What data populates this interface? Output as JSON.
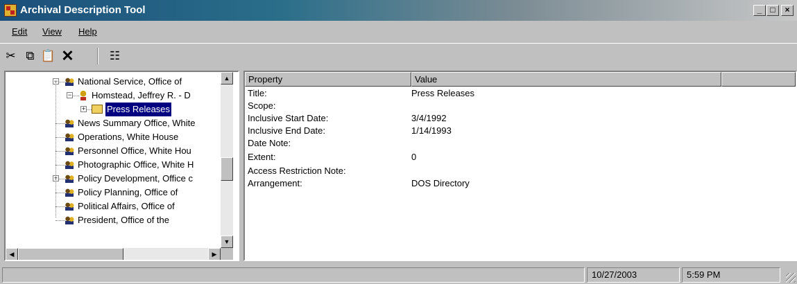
{
  "window": {
    "title": "Archival Description Tool",
    "controls": {
      "minimize": "_",
      "maximize": "□",
      "close": "×"
    }
  },
  "menu": [
    {
      "label": "Edit"
    },
    {
      "label": "View"
    },
    {
      "label": "Help"
    }
  ],
  "toolbar": {
    "buttons": [
      {
        "icon": "scissors-icon",
        "glyph": "✂"
      },
      {
        "icon": "copy-icon",
        "glyph": "⧉"
      },
      {
        "icon": "paste-icon",
        "glyph": "📋"
      },
      {
        "icon": "delete-icon",
        "glyph": "✕"
      },
      {
        "icon": "properties-icon",
        "glyph": "☷"
      }
    ]
  },
  "tree": {
    "items": [
      {
        "label": "National Service, Office of",
        "level": 0,
        "expander": "−",
        "icon": "folk-icon"
      },
      {
        "label": "Homstead, Jeffrey R. - D",
        "level": 1,
        "expander": "−",
        "icon": "person-icon"
      },
      {
        "label": "Press Releases",
        "level": 2,
        "expander": "+",
        "icon": "folder-icon",
        "selected": true
      },
      {
        "label": "News Summary Office, White",
        "level": 0,
        "expander": "",
        "icon": "folk-icon"
      },
      {
        "label": "Operations, White House",
        "level": 0,
        "expander": "",
        "icon": "folk-icon"
      },
      {
        "label": "Personnel Office, White Hou",
        "level": 0,
        "expander": "",
        "icon": "folk-icon"
      },
      {
        "label": "Photographic Office, White H",
        "level": 0,
        "expander": "",
        "icon": "folk-icon"
      },
      {
        "label": "Policy Development, Office c",
        "level": 0,
        "expander": "+",
        "icon": "folk-icon"
      },
      {
        "label": "Policy Planning, Office of",
        "level": 0,
        "expander": "",
        "icon": "folk-icon"
      },
      {
        "label": "Political Affairs, Office of",
        "level": 0,
        "expander": "",
        "icon": "folk-icon"
      },
      {
        "label": "President, Office of the",
        "level": 0,
        "expander": "",
        "icon": "folk-icon"
      }
    ]
  },
  "properties": {
    "columns": [
      "Property",
      "Value",
      ""
    ],
    "rows": [
      {
        "property": "Title:",
        "value": "Press Releases"
      },
      {
        "property": "Scope:",
        "value": ""
      },
      {
        "property": "Inclusive Start Date:",
        "value": "3/4/1992"
      },
      {
        "property": "Inclusive End Date:",
        "value": "1/14/1993"
      },
      {
        "property": "Date Note:",
        "value": ""
      },
      {
        "property": "Extent:",
        "value": "0"
      },
      {
        "property": "Access Restriction Note:",
        "value": ""
      },
      {
        "property": "Arrangement:",
        "value": "DOS Directory"
      }
    ]
  },
  "status": {
    "message": "",
    "date": "10/27/2003",
    "time": "5:59 PM"
  }
}
